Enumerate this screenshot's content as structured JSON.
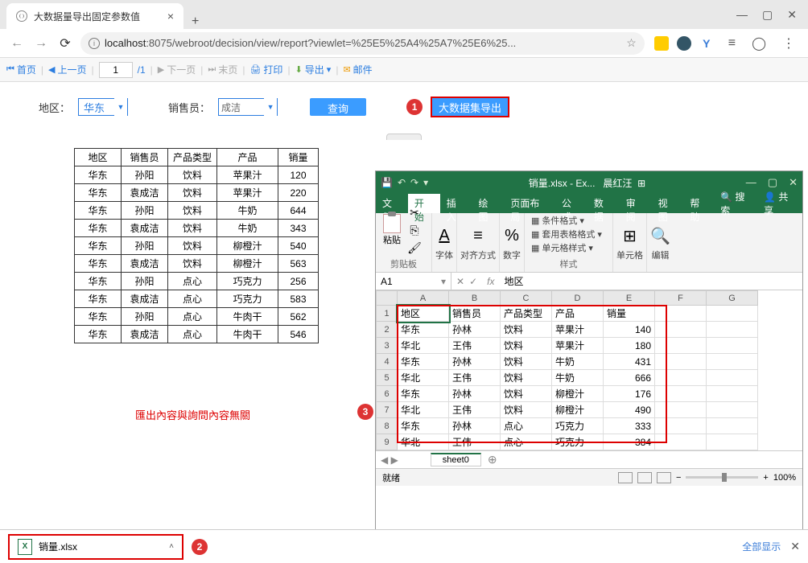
{
  "browser": {
    "tab_title": "大数据量导出固定参数值",
    "url_host": "localhost",
    "url_rest": ":8075/webroot/decision/view/report?viewlet=%25E5%25A4%25A7%25E6%25...",
    "new_tab": "+"
  },
  "report_toolbar": {
    "first": "首页",
    "prev": "上一页",
    "page_num": "1",
    "page_total": "/1",
    "next": "下一页",
    "last": "末页",
    "print": "打印",
    "export": "导出",
    "mail": "邮件"
  },
  "filters": {
    "region_label": "地区：",
    "region_value": "华东",
    "sales_label": "销售员：",
    "sales_value": "成洁",
    "query_btn": "查询",
    "export_btn": "大数据集导出"
  },
  "markers": {
    "m1": "1",
    "m2": "2",
    "m3": "3"
  },
  "web_table": {
    "headers": [
      "地区",
      "销售员",
      "产品类型",
      "产品",
      "销量"
    ],
    "rows": [
      [
        "华东",
        "孙阳",
        "饮料",
        "苹果汁",
        "120"
      ],
      [
        "华东",
        "袁成洁",
        "饮料",
        "苹果汁",
        "220"
      ],
      [
        "华东",
        "孙阳",
        "饮料",
        "牛奶",
        "644"
      ],
      [
        "华东",
        "袁成洁",
        "饮料",
        "牛奶",
        "343"
      ],
      [
        "华东",
        "孙阳",
        "饮料",
        "柳橙汁",
        "540"
      ],
      [
        "华东",
        "袁成洁",
        "饮料",
        "柳橙汁",
        "563"
      ],
      [
        "华东",
        "孙阳",
        "点心",
        "巧克力",
        "256"
      ],
      [
        "华东",
        "袁成洁",
        "点心",
        "巧克力",
        "583"
      ],
      [
        "华东",
        "孙阳",
        "点心",
        "牛肉干",
        "562"
      ],
      [
        "华东",
        "袁成洁",
        "点心",
        "牛肉干",
        "546"
      ]
    ]
  },
  "note": "匯出內容與詢問內容無關",
  "excel": {
    "title_left": "销量.xlsx - Ex...",
    "title_right": "晨红汪",
    "tabs": [
      "文件",
      "开始",
      "插入",
      "绘图",
      "页面布局",
      "公式",
      "数据",
      "审阅",
      "视图",
      "帮助"
    ],
    "search": "搜索",
    "share": "共享",
    "clipboard_label": "剪贴板",
    "paste_label": "粘贴",
    "font_label": "字体",
    "align_label": "对齐方式",
    "number_label": "数字",
    "styles_label": "样式",
    "cells_label": "单元格",
    "edit_label": "编辑",
    "cond_fmt": "条件格式",
    "table_fmt": "套用表格格式",
    "cell_style": "单元格样式",
    "namebox": "A1",
    "fx_value": "地区",
    "sheet_name": "sheet0",
    "status": "就绪",
    "zoom": "100%",
    "headers": [
      "A",
      "B",
      "C",
      "D",
      "E",
      "F",
      "G"
    ],
    "row_hdr": [
      "地区",
      "销售员",
      "产品类型",
      "产品",
      "销量"
    ],
    "rows": [
      [
        "华东",
        "孙林",
        "饮料",
        "苹果汁",
        "140"
      ],
      [
        "华北",
        "王伟",
        "饮料",
        "苹果汁",
        "180"
      ],
      [
        "华东",
        "孙林",
        "饮料",
        "牛奶",
        "431"
      ],
      [
        "华北",
        "王伟",
        "饮料",
        "牛奶",
        "666"
      ],
      [
        "华东",
        "孙林",
        "饮料",
        "柳橙汁",
        "176"
      ],
      [
        "华北",
        "王伟",
        "饮料",
        "柳橙汁",
        "490"
      ],
      [
        "华东",
        "孙林",
        "点心",
        "巧克力",
        "333"
      ],
      [
        "华北",
        "王伟",
        "点心",
        "巧克力",
        "384"
      ]
    ]
  },
  "download": {
    "filename": "销量.xlsx",
    "show_all": "全部显示"
  }
}
